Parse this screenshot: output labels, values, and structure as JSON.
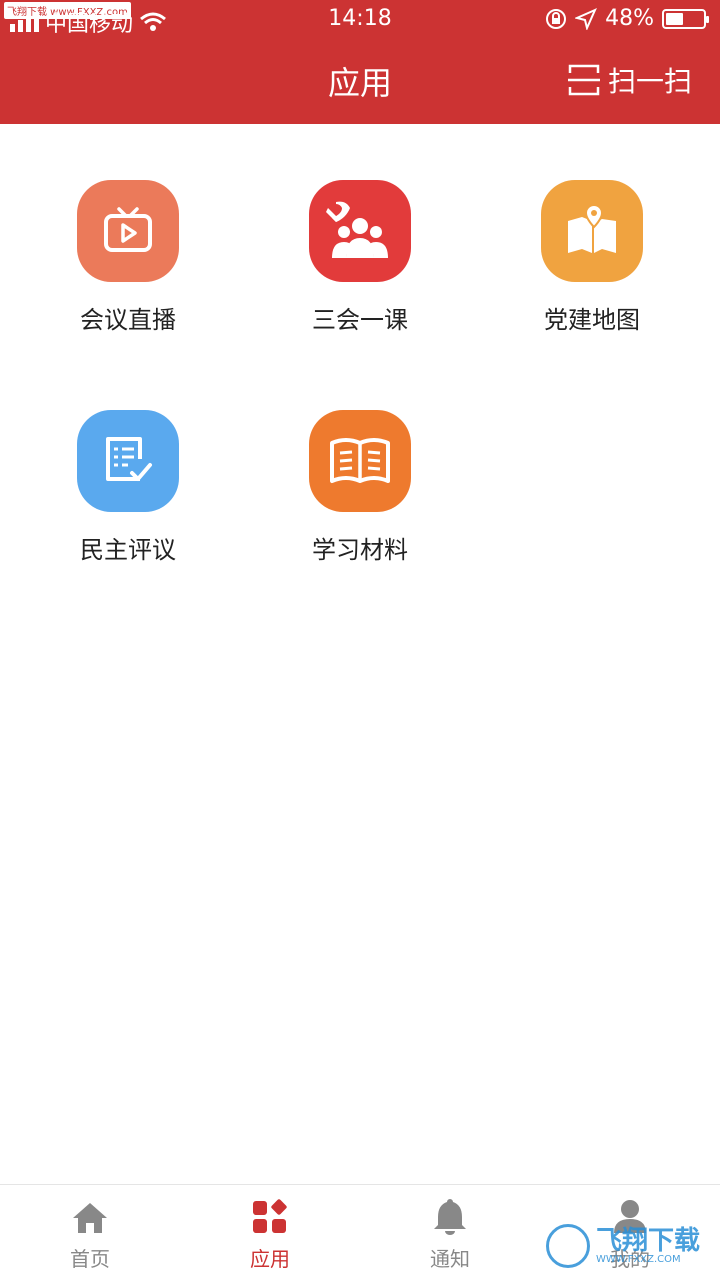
{
  "status_bar": {
    "carrier": "中国移动",
    "time": "14:18",
    "battery_percent": "48%",
    "battery_level": 0.48,
    "watermark_badge": "飞翔下载 www.FXXZ.com"
  },
  "header": {
    "title": "应用",
    "scan_label": "扫一扫"
  },
  "apps": [
    {
      "label": "会议直播",
      "icon": "tv-play-icon",
      "color": "#eb7a5a"
    },
    {
      "label": "三会一课",
      "icon": "party-people-icon",
      "color": "#e23b3b"
    },
    {
      "label": "党建地图",
      "icon": "map-pin-icon",
      "color": "#f0a340"
    },
    {
      "label": "民主评议",
      "icon": "checklist-icon",
      "color": "#5aa9ee"
    },
    {
      "label": "学习材料",
      "icon": "open-book-icon",
      "color": "#ee7a2e"
    }
  ],
  "tabbar": {
    "items": [
      {
        "label": "首页",
        "icon": "home-icon",
        "active": false
      },
      {
        "label": "应用",
        "icon": "apps-grid-icon",
        "active": true
      },
      {
        "label": "通知",
        "icon": "bell-icon",
        "active": false
      },
      {
        "label": "我的",
        "icon": "user-icon",
        "active": false
      }
    ]
  },
  "watermark": {
    "text": "飞翔下载",
    "sub": "WWW.FXXZ.COM"
  },
  "colors": {
    "primary": "#cc3333",
    "tab_inactive": "#888888"
  }
}
